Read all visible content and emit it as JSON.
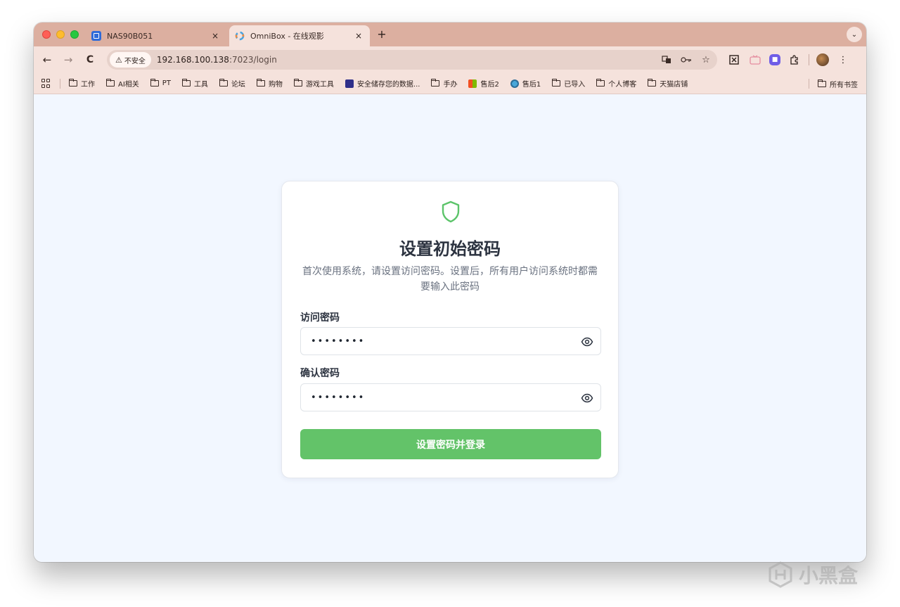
{
  "browser": {
    "tabs": [
      {
        "title": "NAS90B051",
        "close": "×"
      },
      {
        "title": "OmniBox - 在线观影",
        "close": "×"
      }
    ],
    "new_tab": "+",
    "tab_menu": "⌄",
    "nav": {
      "back": "←",
      "forward": "→",
      "reload": "C"
    },
    "security_label": "不安全",
    "url_host": "192.168.100.138",
    "url_path": ":7023/login"
  },
  "bookmarks": [
    {
      "label": "工作",
      "icon": "folder-icon"
    },
    {
      "label": "AI相关",
      "icon": "folder-icon"
    },
    {
      "label": "PT",
      "icon": "folder-icon"
    },
    {
      "label": "工具",
      "icon": "folder-icon"
    },
    {
      "label": "论坛",
      "icon": "folder-icon"
    },
    {
      "label": "购物",
      "icon": "folder-icon"
    },
    {
      "label": "游戏工具",
      "icon": "folder-icon"
    },
    {
      "label": "安全储存您的数据...",
      "icon": "nas-icon"
    },
    {
      "label": "手办",
      "icon": "folder-icon"
    },
    {
      "label": "售后2",
      "icon": "microsoft-icon"
    },
    {
      "label": "售后1",
      "icon": "globe-icon"
    },
    {
      "label": "已导入",
      "icon": "folder-icon"
    },
    {
      "label": "个人博客",
      "icon": "folder-icon"
    },
    {
      "label": "天猫店铺",
      "icon": "folder-icon"
    }
  ],
  "bookmarks_all": "所有书签",
  "login": {
    "title": "设置初始密码",
    "description": "首次使用系统，请设置访问密码。设置后，所有用户访问系统时都需要输入此密码",
    "password_label": "访问密码",
    "password_value": "••••••••",
    "confirm_label": "确认密码",
    "confirm_value": "••••••••",
    "submit_label": "设置密码并登录"
  },
  "watermark": "小黑盒",
  "colors": {
    "accent_green": "#63c369",
    "shield_green": "#5cc46a",
    "tab_strip": "#dcafa0",
    "toolbar": "#f5e2dc",
    "page_bg": "#f2f7ff"
  }
}
